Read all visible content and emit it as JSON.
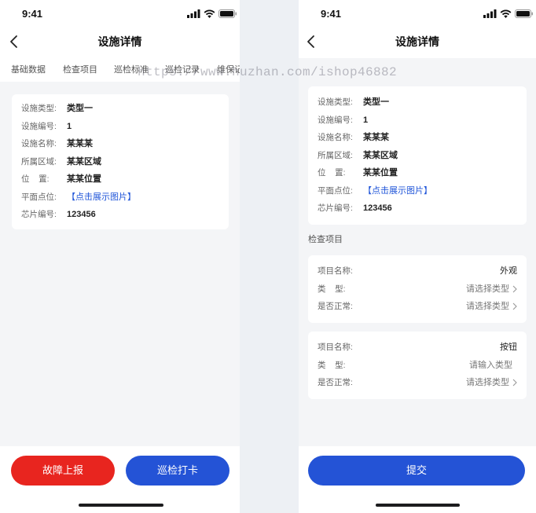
{
  "watermark": "https://www.huzhan.com/ishop46882",
  "colors": {
    "danger_red": "#e8251f",
    "primary_blue": "#2453d6",
    "link_blue": "#2156d9",
    "page_gray": "#f4f5f7"
  },
  "left": {
    "status": {
      "time": "9:41"
    },
    "nav": {
      "title": "设施详情"
    },
    "tabs": [
      "基础数据",
      "检查项目",
      "巡检标准",
      "巡检记录",
      "维保记录"
    ],
    "info": [
      {
        "label": "设施类型:",
        "value": "类型一"
      },
      {
        "label": "设施编号:",
        "value": "1"
      },
      {
        "label": "设施名称:",
        "value": "某某某"
      },
      {
        "label": "所属区域:",
        "value": "某某区域"
      },
      {
        "label": "位    置:",
        "value": "某某位置"
      },
      {
        "label": "平面点位:",
        "value": "【点击展示图片】"
      },
      {
        "label": "芯片编号:",
        "value": "123456"
      }
    ],
    "buttons": {
      "report": "故障上报",
      "checkin": "巡检打卡"
    }
  },
  "right": {
    "status": {
      "time": "9:41"
    },
    "nav": {
      "title": "设施详情"
    },
    "info": [
      {
        "label": "设施类型:",
        "value": "类型一"
      },
      {
        "label": "设施编号:",
        "value": "1"
      },
      {
        "label": "设施名称:",
        "value": "某某某"
      },
      {
        "label": "所属区域:",
        "value": "某某区域"
      },
      {
        "label": "位    置:",
        "value": "某某位置"
      },
      {
        "label": "平面点位:",
        "value": "【点击展示图片】"
      },
      {
        "label": "芯片编号:",
        "value": "123456"
      }
    ],
    "section_title": "检查项目",
    "items": [
      {
        "rows": [
          {
            "label": "项目名称:",
            "value": "外观"
          },
          {
            "label": "类    型:",
            "value": "请选择类型"
          },
          {
            "label": "是否正常:",
            "value": "请选择类型"
          }
        ]
      },
      {
        "rows": [
          {
            "label": "项目名称:",
            "value": "按钮"
          },
          {
            "label": "类    型:",
            "value": "请输入类型"
          },
          {
            "label": "是否正常:",
            "value": "请选择类型"
          }
        ]
      }
    ],
    "submit": "提交"
  }
}
